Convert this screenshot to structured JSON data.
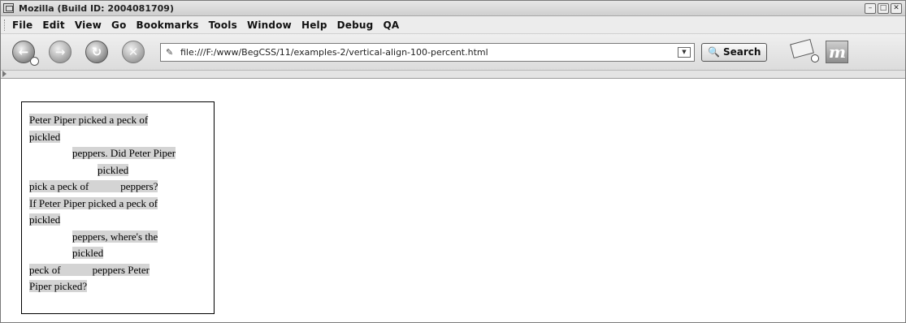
{
  "window": {
    "title": "Mozilla (Build ID: 2004081709)"
  },
  "window_controls": [
    "minimize",
    "maximize",
    "close"
  ],
  "menu": {
    "items": [
      "File",
      "Edit",
      "View",
      "Go",
      "Bookmarks",
      "Tools",
      "Window",
      "Help",
      "Debug",
      "QA"
    ]
  },
  "toolbar": {
    "back_glyph": "←",
    "forward_glyph": "→",
    "reload_glyph": "↻",
    "stop_glyph": "✕",
    "url": "file:///F:/www/BegCSS/11/examples-2/vertical-align-100-percent.html",
    "url_icon": "✎",
    "search_label": "Search",
    "search_icon": "🔍",
    "throbber_letter": "m"
  },
  "content": {
    "lines": [
      {
        "indent": 0,
        "text": "Peter Piper picked a peck of"
      },
      {
        "indent": 0,
        "text": "pickled"
      },
      {
        "indent": 53,
        "text": "peppers. Did Peter Piper"
      },
      {
        "indent": 84,
        "text": "pickled"
      },
      {
        "indent": 0,
        "text": "pick a peck of            peppers?"
      },
      {
        "indent": 0,
        "text": "If Peter Piper picked a peck of"
      },
      {
        "indent": 0,
        "text": "pickled"
      },
      {
        "indent": 53,
        "text": "peppers, where's the"
      },
      {
        "indent": 53,
        "text": "pickled"
      },
      {
        "indent": 0,
        "text": "peck of            peppers Peter"
      },
      {
        "indent": 0,
        "text": "Piper picked?"
      }
    ]
  },
  "colors": {
    "highlight": "#d4d4d4",
    "chrome": "#e6e6e6"
  }
}
